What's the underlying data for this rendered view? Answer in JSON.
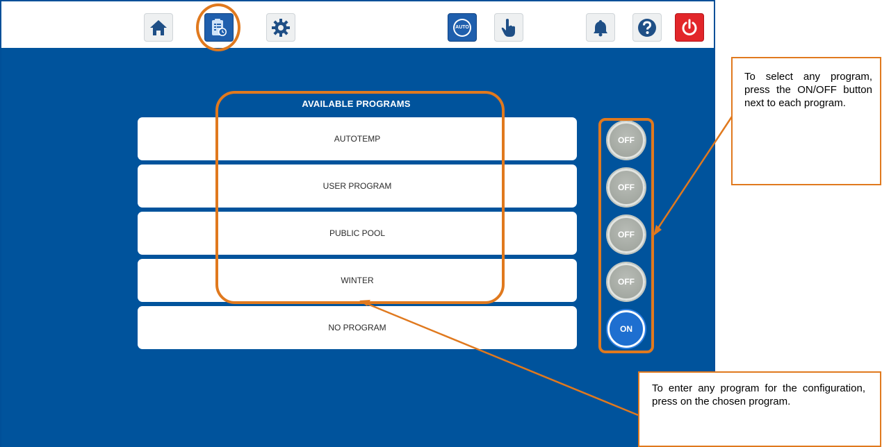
{
  "toolbar": {
    "home_icon": "home-icon",
    "programs_icon": "programs-clipboard-icon",
    "settings_icon": "gear-icon",
    "auto_label": "AUTO",
    "manual_icon": "hand-pointer-icon",
    "alarm_icon": "bell-icon",
    "help_icon": "question-icon",
    "power_icon": "power-icon"
  },
  "programs": {
    "title": "AVAILABLE PROGRAMS",
    "items": [
      {
        "label": "AUTOTEMP",
        "state": "OFF"
      },
      {
        "label": "USER PROGRAM",
        "state": "OFF"
      },
      {
        "label": "PUBLIC POOL",
        "state": "OFF"
      },
      {
        "label": "WINTER",
        "state": "OFF"
      },
      {
        "label": "NO PROGRAM",
        "state": "ON"
      }
    ]
  },
  "callouts": {
    "select_program": "To select any program, press the ON/OFF button next to each program.",
    "enter_program": "To enter any program for the configuration, press on the chosen program."
  },
  "colors": {
    "accent_orange": "#e0791e",
    "panel_blue": "#00539c",
    "on_blue": "#1e6fd0",
    "power_red": "#e2262a"
  }
}
